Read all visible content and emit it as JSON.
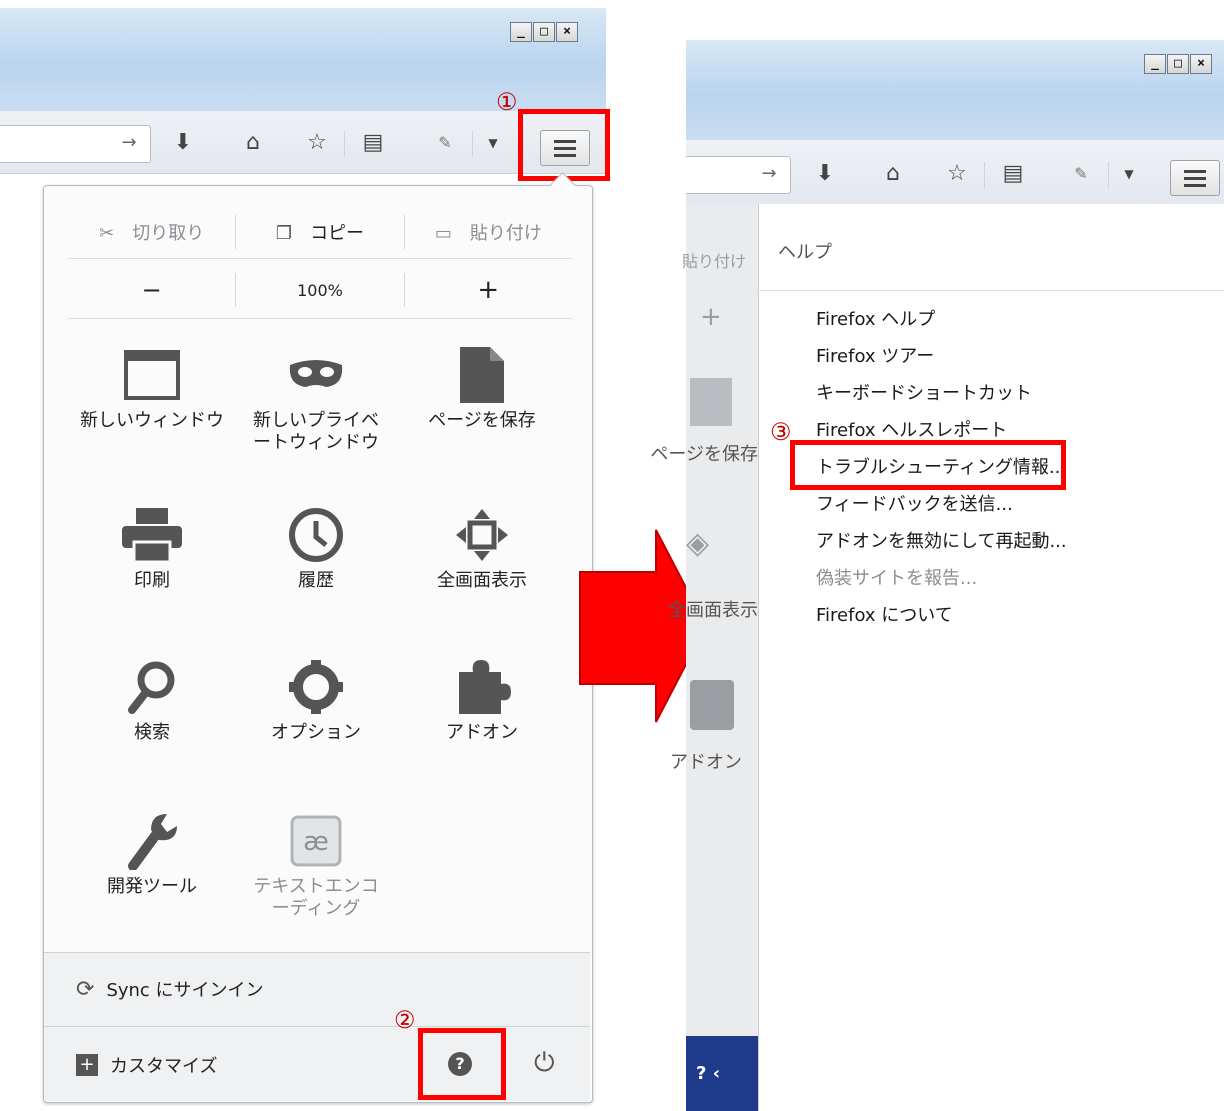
{
  "left": {
    "window_buttons": [
      "_",
      "□",
      "×"
    ],
    "edit_row": {
      "cut": "切り取り",
      "copy": "コピー",
      "paste": "貼り付け"
    },
    "zoom_row": {
      "minus": "−",
      "level": "100%",
      "plus": "+"
    },
    "grid": [
      {
        "icon": "new-window-icon",
        "label": "新しいウィンドウ"
      },
      {
        "icon": "private-window-icon",
        "label": "新しいプライベートウィンドウ"
      },
      {
        "icon": "save-page-icon",
        "label": "ページを保存"
      },
      {
        "icon": "print-icon",
        "label": "印刷"
      },
      {
        "icon": "history-icon",
        "label": "履歴"
      },
      {
        "icon": "fullscreen-icon",
        "label": "全画面表示"
      },
      {
        "icon": "search-icon",
        "label": "検索"
      },
      {
        "icon": "options-icon",
        "label": "オプション"
      },
      {
        "icon": "addons-icon",
        "label": "アドオン"
      },
      {
        "icon": "developer-tools-icon",
        "label": "開発ツール"
      },
      {
        "icon": "text-encoding-icon",
        "label": "テキストエンコーディング"
      }
    ],
    "sync_label": "Sync にサインイン",
    "customize_label": "カスタマイズ",
    "marker_1": "①",
    "marker_2": "②"
  },
  "right": {
    "window_buttons": [
      "_",
      "□",
      "×"
    ],
    "help_title": "ヘルプ",
    "help_items": [
      {
        "label": "Firefox ヘルプ",
        "enabled": true
      },
      {
        "label": "Firefox ツアー",
        "enabled": true
      },
      {
        "label": "キーボードショートカット",
        "enabled": true
      },
      {
        "label": "Firefox ヘルスレポート",
        "enabled": true
      },
      {
        "label": "トラブルシューティング情報...",
        "enabled": true
      },
      {
        "label": "フィードバックを送信...",
        "enabled": true
      },
      {
        "label": "アドオンを無効にして再起動...",
        "enabled": true
      },
      {
        "label": "偽装サイトを報告...",
        "enabled": false
      },
      {
        "label": "Firefox について",
        "enabled": true
      }
    ],
    "side_peek": {
      "paste": "貼り付け",
      "plus": "+",
      "save": "ページを保存",
      "fullscreen": "全画面表示",
      "addons": "アドオン"
    },
    "marker_3": "③"
  },
  "colors": {
    "highlight": "#ff0000",
    "arrow": "#ff0000",
    "marker": "#c00000"
  }
}
